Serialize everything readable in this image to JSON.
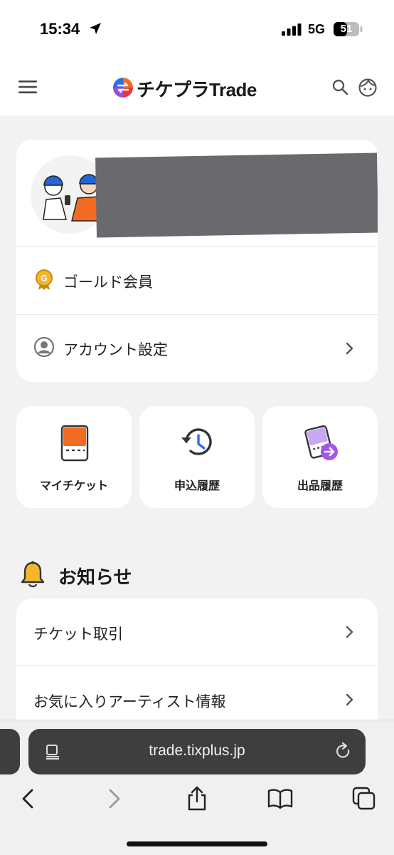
{
  "status_bar": {
    "time": "15:34",
    "network": "5G",
    "battery": "51"
  },
  "header": {
    "logo_text": "チケプラTrade",
    "icons": [
      "menu-icon",
      "search-icon",
      "user-face-icon"
    ]
  },
  "profile": {
    "rows": [
      {
        "label": "ゴールド会員",
        "icon": "gold-medal-icon"
      },
      {
        "label": "アカウント設定",
        "icon": "account-icon"
      }
    ]
  },
  "quick_actions": [
    {
      "label": "マイチケット",
      "icon": "ticket-icon"
    },
    {
      "label": "申込履歴",
      "icon": "history-icon"
    },
    {
      "label": "出品履歴",
      "icon": "listing-history-icon"
    }
  ],
  "notices": {
    "title": "お知らせ",
    "items": [
      {
        "label": "チケット取引"
      },
      {
        "label": "お気に入りアーティスト情報"
      }
    ]
  },
  "browser": {
    "url": "trade.tixplus.jp"
  },
  "colors": {
    "accent_orange": "#f26b22",
    "accent_purple": "#a258e8",
    "header_bg": "#ffffff",
    "page_bg": "#f2f2f2",
    "gold": "#e5a823"
  }
}
